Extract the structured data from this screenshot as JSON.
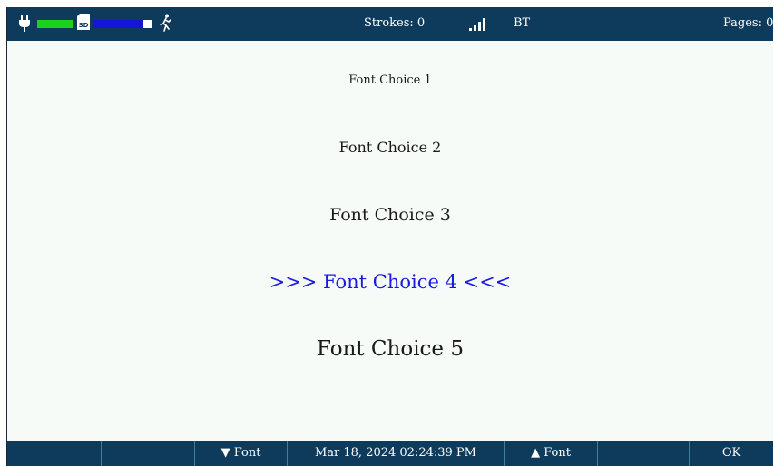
{
  "status_bar": {
    "strokes_label": "Strokes: 0",
    "connection_label": "BT",
    "pages_label": "Pages: 0",
    "battery_level": 1.0,
    "storage_level": 0.85,
    "colors": {
      "bar_bg": "#0e3b5c",
      "battery": "#1bd11b",
      "storage": "#1515d8"
    },
    "icons": [
      "power-plug-icon",
      "sd-card-icon",
      "running-person-icon",
      "signal-strength-icon"
    ]
  },
  "font_menu": {
    "choices": [
      {
        "label": "Font Choice 1",
        "selected": false
      },
      {
        "label": "Font Choice 2",
        "selected": false
      },
      {
        "label": "Font Choice 3",
        "selected": false
      },
      {
        "label": ">>>  Font Choice 4  <<<",
        "selected": true
      },
      {
        "label": "Font Choice 5",
        "selected": false
      }
    ],
    "selected_color": "#1a1ae0"
  },
  "softkeys": {
    "key1": "",
    "key2": "",
    "font_down": "▼ Font",
    "datetime": "Mar 18, 2024  02:24:39 PM",
    "font_up": "▲ Font",
    "key6": "",
    "ok": "OK"
  }
}
